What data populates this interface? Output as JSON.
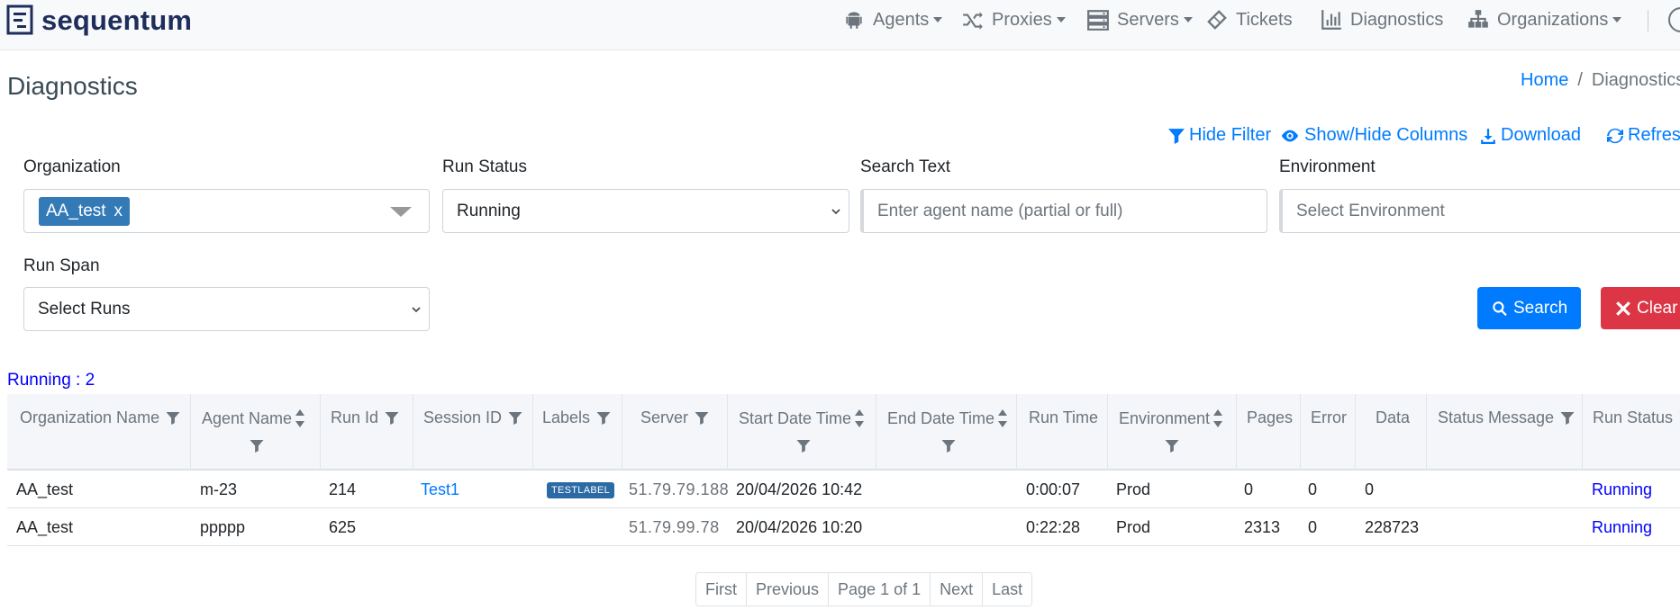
{
  "brand": {
    "name": "sequentum"
  },
  "nav": {
    "items": [
      {
        "label": "Agents",
        "icon": "android-icon",
        "dropdown": true
      },
      {
        "label": "Proxies",
        "icon": "shuffle-icon",
        "dropdown": true
      },
      {
        "label": "Servers",
        "icon": "server-icon",
        "dropdown": true
      },
      {
        "label": "Tickets",
        "icon": "ticket-icon",
        "dropdown": false
      },
      {
        "label": "Diagnostics",
        "icon": "bar-chart-icon",
        "dropdown": false
      },
      {
        "label": "Organizations",
        "icon": "sitemap-icon",
        "dropdown": true
      }
    ]
  },
  "page": {
    "title": "Diagnostics"
  },
  "breadcrumb": {
    "home": "Home",
    "separator": "/",
    "current": "Diagnostics"
  },
  "actions": {
    "hide_filter": "Hide Filter",
    "show_hide_columns": "Show/Hide Columns",
    "download": "Download",
    "refresh": "Refresh"
  },
  "filters": {
    "organization": {
      "label": "Organization",
      "selected_tag": "AA_test",
      "tag_remove": "x"
    },
    "run_status": {
      "label": "Run Status",
      "value": "Running"
    },
    "search_text": {
      "label": "Search Text",
      "placeholder": "Enter agent name (partial or full)"
    },
    "environment": {
      "label": "Environment",
      "placeholder": "Select Environment"
    },
    "run_span": {
      "label": "Run Span",
      "value": "Select Runs"
    }
  },
  "buttons": {
    "search": "Search",
    "clear": "Clear"
  },
  "summary": {
    "running_count": "Running : 2"
  },
  "table": {
    "columns": {
      "organization_name": "Organization Name",
      "agent_name": "Agent Name",
      "run_id": "Run Id",
      "session_id": "Session ID",
      "labels": "Labels",
      "server": "Server",
      "start_date_time": "Start Date Time",
      "end_date_time": "End Date Time",
      "run_time": "Run Time",
      "environment": "Environment",
      "pages": "Pages",
      "error": "Error",
      "data": "Data",
      "status_message": "Status Message",
      "run_status": "Run Status"
    },
    "rows": [
      {
        "organization": "AA_test",
        "agent": "m-23",
        "run_id": "214",
        "session_id": "Test1",
        "label": "TESTLABEL",
        "server": "51.79.79.188",
        "start": "20/04/2026 10:42",
        "end": "",
        "run_time": "0:00:07",
        "environment": "Prod",
        "pages": "0",
        "error": "0",
        "data": "0",
        "status_message": "",
        "run_status": "Running"
      },
      {
        "organization": "AA_test",
        "agent": "ppppp",
        "run_id": "625",
        "session_id": "",
        "label": "",
        "server": "51.79.99.78",
        "start": "20/04/2026 10:20",
        "end": "",
        "run_time": "0:22:28",
        "environment": "Prod",
        "pages": "2313",
        "error": "0",
        "data": "228723",
        "status_message": "",
        "run_status": "Running"
      }
    ]
  },
  "pagination": {
    "first": "First",
    "previous": "Previous",
    "page_info": "Page 1 of 1",
    "next": "Next",
    "last": "Last"
  },
  "colors": {
    "primary": "#007bff",
    "danger": "#dc3545",
    "tag": "#337ab7",
    "brand": "#1e2d5c",
    "status": "#0000ff"
  }
}
